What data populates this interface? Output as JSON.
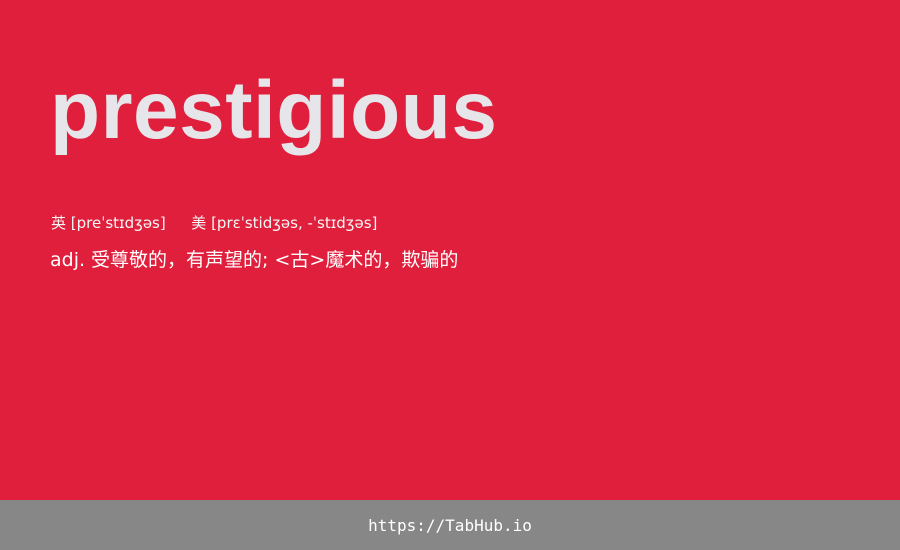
{
  "word": "prestigious",
  "phonetics": {
    "uk_label": "英",
    "uk": "[preˈstɪdʒəs]",
    "us_label": "美",
    "us": "[prɛˈstidʒəs, -ˈstɪdʒəs]"
  },
  "definition": "adj. 受尊敬的，有声望的; <古>魔术的，欺骗的",
  "footer": {
    "link": "https://TabHub.io"
  },
  "colors": {
    "background": "#e01f3d",
    "word": "#e6e6ea",
    "footer_bg": "#878787"
  }
}
